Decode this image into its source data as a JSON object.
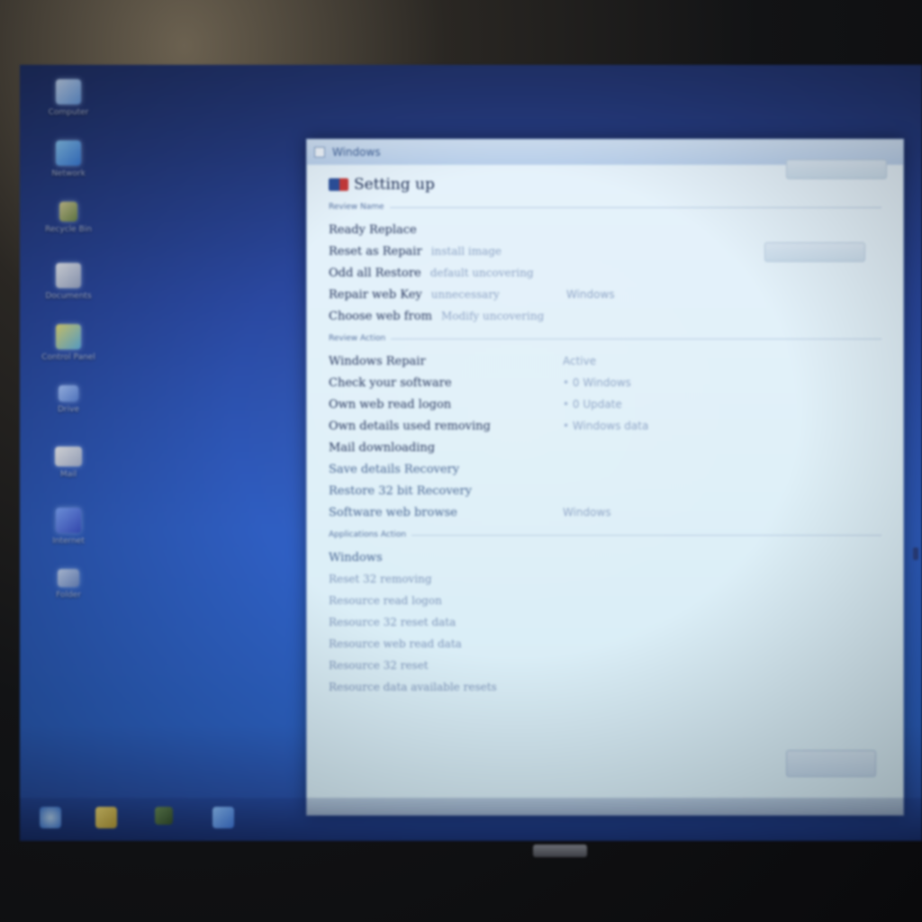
{
  "window": {
    "title": "Windows",
    "page_title": "Setting up",
    "section1": {
      "header": "Review Name",
      "rows": [
        {
          "label": "Ready Replace",
          "aux": "",
          "value": ""
        },
        {
          "label": "Reset as Repair",
          "aux": "install image",
          "value": ""
        },
        {
          "label": "Odd all Restore",
          "aux": "default uncovering",
          "value": ""
        },
        {
          "label": "Repair web Key",
          "aux": "unnecessary",
          "value": "Windows"
        },
        {
          "label": "Choose web from",
          "aux": "Modify uncovering",
          "value": ""
        }
      ]
    },
    "section2": {
      "header": "Review Action",
      "rows": [
        {
          "label": "Windows Repair",
          "value": "Active"
        },
        {
          "label": "Check your software",
          "value": "0 Windows"
        },
        {
          "label": "Own web read logon",
          "value": "0 Update"
        },
        {
          "label": "Own details used removing",
          "value": "Windows data"
        },
        {
          "label": "Mail downloading",
          "value": ""
        },
        {
          "label": "Save details Recovery",
          "value": ""
        },
        {
          "label": "Restore 32 bit Recovery",
          "value": ""
        },
        {
          "label": "Software web browse",
          "value": "Windows"
        }
      ]
    },
    "section3": {
      "header": "Applications Action",
      "rows": [
        {
          "label": "Windows"
        },
        {
          "label": "Reset 32 removing"
        },
        {
          "label": "Resource read logon"
        },
        {
          "label": "Resource 32 reset data"
        },
        {
          "label": "Resource web read data"
        },
        {
          "label": "Resource 32 reset"
        },
        {
          "label": "Resource data available resets"
        }
      ]
    },
    "ok_label": ""
  },
  "desktop": {
    "icons": [
      {
        "icon": "computer-icon",
        "label": "Computer"
      },
      {
        "icon": "network-icon",
        "label": "Network"
      },
      {
        "icon": "recycle-bin-icon",
        "label": "Recycle Bin"
      },
      {
        "icon": "document-icon",
        "label": "Documents"
      },
      {
        "icon": "control-panel-icon",
        "label": "Control Panel"
      },
      {
        "icon": "shortcut-icon",
        "label": "Drive"
      },
      {
        "icon": "mail-icon",
        "label": "Mail"
      },
      {
        "icon": "browser-icon",
        "label": "Internet"
      },
      {
        "icon": "folder-icon",
        "label": "Folder"
      }
    ]
  },
  "colors": {
    "desktop_blue": "#2d5ec2",
    "window_bg": "#e2f1f9",
    "title_text": "#1f2f55"
  }
}
